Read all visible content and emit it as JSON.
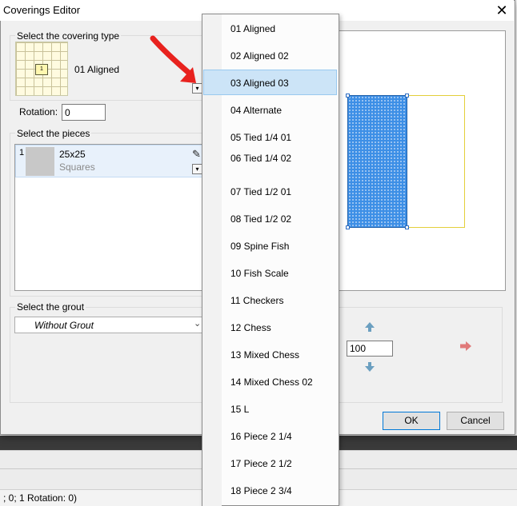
{
  "dialog": {
    "title": "Coverings Editor",
    "close_glyph": "✕",
    "covering_type": {
      "label": "Select the covering type",
      "selected": "01 Aligned",
      "thumb_center_text": "1"
    },
    "rotation": {
      "label": "Rotation:",
      "value": "0"
    },
    "pieces": {
      "label": "Select the pieces",
      "items": [
        {
          "index": "1",
          "name": "25x25",
          "type": "Squares"
        }
      ]
    },
    "grout": {
      "label": "Select the grout",
      "selected": "Without Grout"
    },
    "scale_value": "100",
    "ok_label": "OK",
    "cancel_label": "Cancel"
  },
  "dropdown": {
    "selected_index": 2,
    "items": [
      "01 Aligned",
      "02 Aligned 02",
      "03 Aligned 03",
      "04 Alternate",
      "05 Tied 1/4 01",
      "06 Tied 1/4 02",
      "07 Tied 1/2 01",
      "08 Tied 1/2 02",
      "09 Spine Fish",
      "10 Fish Scale",
      "11 Checkers",
      "12 Chess",
      "13 Mixed Chess",
      "14 Mixed Chess 02",
      "15 L",
      "16 Piece 2 1/4",
      "17 Piece 2 1/2",
      "18 Piece 2 3/4"
    ]
  },
  "status_bar": {
    "text": "; 0; 1 Rotation: 0)"
  },
  "colors": {
    "selection": "#cce4f7",
    "preview_fill": "#3d8fe6",
    "preview_outline": "#e3cf3a",
    "arrow_red": "#e8221e"
  }
}
